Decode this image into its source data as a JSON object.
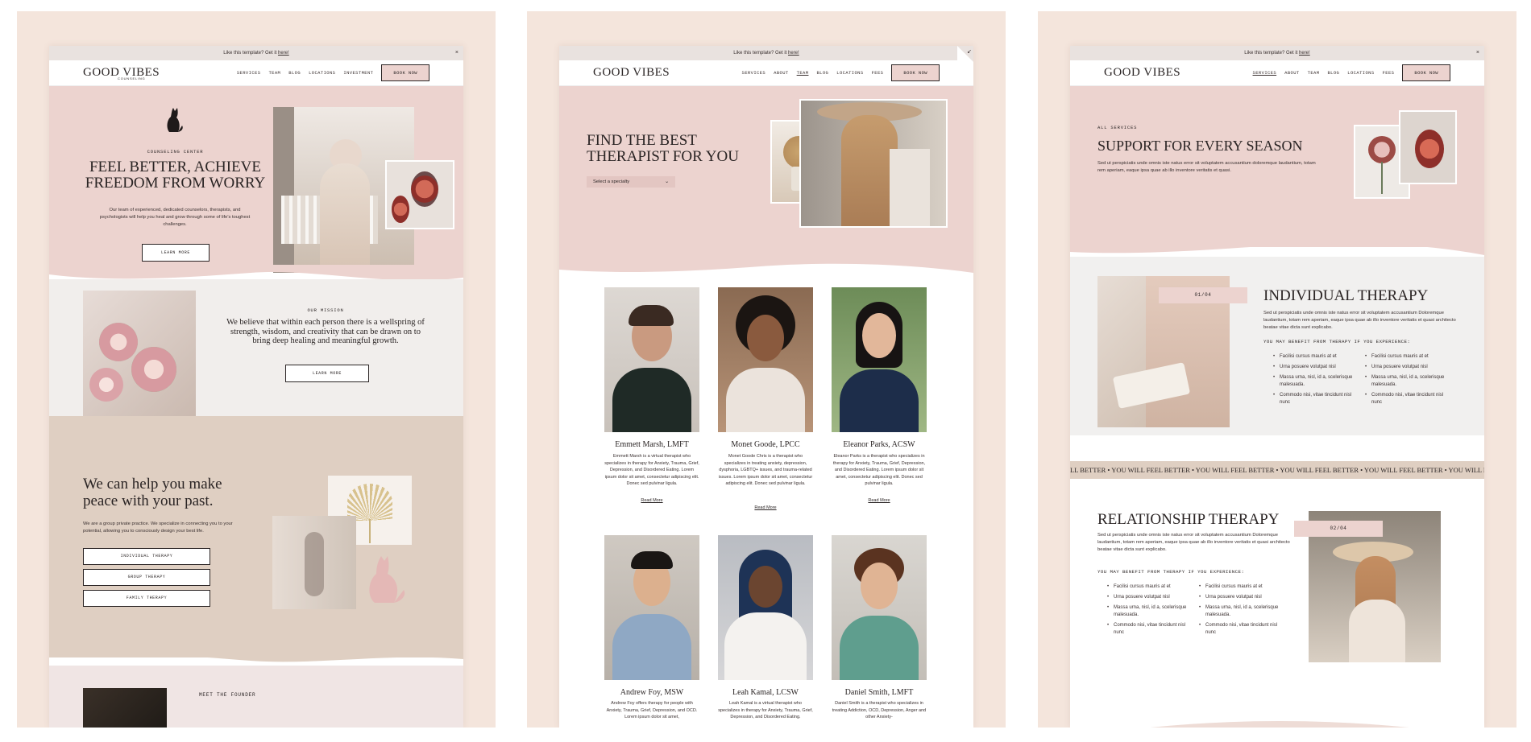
{
  "promo": {
    "text": "Like this template? Get it ",
    "link": "here!",
    "close": "×"
  },
  "brand": {
    "name": "GOOD VIBES",
    "sub": "COUNSELING"
  },
  "nav": {
    "home": [
      "SERVICES",
      "TEAM",
      "BLOG",
      "LOCATIONS",
      "INVESTMENT"
    ],
    "team": [
      "SERVICES",
      "ABOUT",
      "TEAM",
      "BLOG",
      "LOCATIONS",
      "FEES"
    ],
    "services": [
      "SERVICES",
      "ABOUT",
      "TEAM",
      "BLOG",
      "LOCATIONS",
      "FEES"
    ],
    "book": "BOOK NOW"
  },
  "home": {
    "eyebrow": "COUNSELING CENTER",
    "title1": "FEEL BETTER, ACHIEVE",
    "title2": "FREEDOM FROM WORRY",
    "intro": "Our team of experienced, dedicated counselors, therapists, and psychologists will help you heal and grow through some of life's toughest challenges.",
    "learn": "LEARN MORE",
    "mission_label": "OUR MISSION",
    "mission": "We believe that within each person there is a wellspring of strength, wisdom, and creativity that can be drawn on to bring deep healing and meaningful growth.",
    "mission_btn": "LEARN MORE",
    "help_title": "We can help you make peace with your past.",
    "help_text": "We are a group private practice. We specialize in connecting you to your potential, allowing you to consciously design your best life.",
    "services": [
      "INDIVIDUAL THERAPY",
      "GROUP THERAPY",
      "FAMILY THERAPY"
    ],
    "founder": "MEET THE FOUNDER"
  },
  "team": {
    "title1": "FIND THE BEST",
    "title2": "THERAPIST FOR YOU",
    "select": "Select a specialty",
    "read_more": "Read More",
    "members": [
      {
        "name": "Emmett Marsh, LMFT",
        "bio": "Emmett Marsh is a virtual therapist who specializes in therapy for Anxiety, Trauma, Grief, Depression, and Disordered Eating. Lorem ipsum dolor sit amet, consectetur adipiscing elit. Donec sed pulvinar ligula."
      },
      {
        "name": "Monet Goode, LPCC",
        "bio": "Monet Goode Chris is a therapist who specializes in treating anxiety, depression, dysphoria, LGBTQ+ issues, and trauma-related issues. Lorem ipsum dolor sit amet, consectetur adipiscing elit. Donec sed pulvinar ligula."
      },
      {
        "name": "Eleanor Parks, ACSW",
        "bio": "Eleanor Parks is a therapist who specializes in therapy for Anxiety, Trauma, Grief, Depression, and Disordered Eating. Lorem ipsum dolor sit amet, consectetur adipiscing elit. Donec sed pulvinar ligula."
      },
      {
        "name": "Andrew Foy, MSW",
        "bio": "Andrew Foy offers therapy for people with Anxiety, Trauma, Grief, Depression, and OCD. Lorem ipsum dolor sit amet,"
      },
      {
        "name": "Leah Kamal, LCSW",
        "bio": "Leah Kamal is a virtual therapist who specializes in therapy for Anxiety, Trauma, Grief, Depression, and Disordered Eating."
      },
      {
        "name": "Daniel Smith, LMFT",
        "bio": "Daniel Smith is a therapist who specializes in treating Addiction, OCD, Depression, Anger and other Anxiety-"
      }
    ]
  },
  "services": {
    "eyebrow": "ALL SERVICES",
    "title": "SUPPORT FOR EVERY SEASON",
    "intro": "Sed ut perspiciatis unde omnis iste natus error sit voluptatem accusantium doloremque laudantium, totam rem aperiam, eaque ipsa quae ab illo inventore veritatis et quasi.",
    "ind_tag": "01/04",
    "ind_title": "INDIVIDUAL THERAPY",
    "ind_text": "Sed ut perspiciatis unde omnis iste natus error sit voluptatem accusantium Doloremque laudantium, totam rem aperiam, eaque ipsa quae ab illo inventore veritatis et quasi architecto beatae vitae dicta sunt explicabo.",
    "benefit": "YOU MAY BENEFIT FROM THERAPY IF YOU EXPERIENCE:",
    "list_a": [
      "Facilisi cursus mauris at et",
      "Urna posuere volutpat nisl",
      "Massa urna, nisl, id a, scelerisque malesuada.",
      "Commodo nisi, vitae tincidunt nisl nunc"
    ],
    "list_b": [
      "Facilisi cursus mauris at et",
      "Urna posuere volutpat nisl",
      "Massa urna, nisl, id a, scelerisque malesuada.",
      "Commodo nisi, vitae tincidunt nisl nunc"
    ],
    "marquee": "LL BETTER  •  YOU WILL FEEL BETTER  •  YOU WILL FEEL BETTER  •  YOU WILL FEEL BETTER  •  YOU WILL FEEL BETTER  •  YOU WILL F",
    "rel_tag": "02/04",
    "rel_title": "RELATIONSHIP THERAPY",
    "rel_text": "Sed ut perspiciatis unde omnis iste natus error sit voluptatem accusantium Doloremque laudantium, totam rem aperiam, eaque ipsa quae ab illo inventore veritatis et quasi architecto beatae vitae dicta sunt explicabo."
  },
  "colors": {
    "blush": "#ecd3cf",
    "sand": "#dfcfc2",
    "cream": "#f4e5dc",
    "ink": "#2a2424"
  }
}
